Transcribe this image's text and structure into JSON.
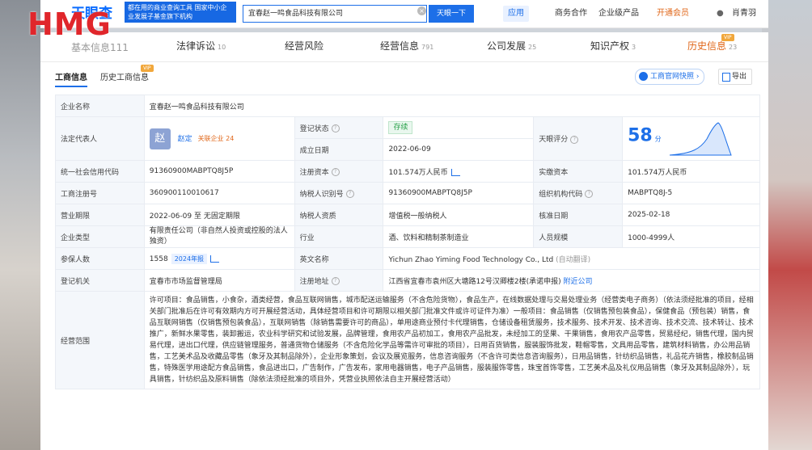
{
  "watermark": "HMG",
  "topbar": {
    "brand": "天眼查",
    "slogan": "都在用的商业查询工具 国家中小企业发展子基金旗下机构",
    "search_value": "宜春赵一鸣食品科技有限公司",
    "search_button": "天眼一下",
    "nav_app": "应用",
    "nav_items": [
      "商务合作",
      "企业级产品",
      "开通会员",
      "肖青羽"
    ]
  },
  "tabs": [
    {
      "label": "基本信息",
      "count": "111"
    },
    {
      "label": "法律诉讼",
      "count": "10"
    },
    {
      "label": "经营风险",
      "count": ""
    },
    {
      "label": "经营信息",
      "count": "791"
    },
    {
      "label": "公司发展",
      "count": "25"
    },
    {
      "label": "知识产权",
      "count": "3"
    },
    {
      "label": "历史信息",
      "count": "23"
    }
  ],
  "vip_label": "VIP",
  "subtabs": [
    "工商信息",
    "历史工商信息"
  ],
  "buttons": {
    "gov": "工商官网快照",
    "export": "导出"
  },
  "info": {
    "company_name_label": "企业名称",
    "company_name": "宜春赵一鸣食品科技有限公司",
    "legal_rep_label": "法定代表人",
    "legal_rep_avatar": "赵",
    "legal_rep_name": "赵定",
    "legal_rep_tag": "关联企业 24",
    "status_label": "登记状态",
    "status": "存续",
    "found_label": "成立日期",
    "found_date": "2022-06-09",
    "score_label": "天眼评分",
    "score": "58",
    "score_unit": "分",
    "credit_code_label": "统一社会信用代码",
    "credit_code": "91360900MABPTQ8J5P",
    "reg_capital_label": "注册资本",
    "reg_capital": "101.574万人民币",
    "paid_capital_label": "实缴资本",
    "paid_capital": "101.574万人民币",
    "reg_no_label": "工商注册号",
    "reg_no": "360900110010617",
    "tax_id_label": "纳税人识别号",
    "tax_id": "91360900MABPTQ8J5P",
    "org_code_label": "组织机构代码",
    "org_code": "MABPTQ8J-5",
    "term_label": "营业期限",
    "term": "2022-06-09 至 无固定期限",
    "tax_qual_label": "纳税人资质",
    "tax_qual": "增值税一般纳税人",
    "approve_label": "核准日期",
    "approve_date": "2025-02-18",
    "type_label": "企业类型",
    "type": "有限责任公司（非自然人投资或控股的法人独资）",
    "industry_label": "行业",
    "industry": "酒、饮料和精制茶制造业",
    "staff_label": "人员规模",
    "staff": "1000-4999人",
    "insured_label": "参保人数",
    "insured": "1558",
    "insured_tag": "2024年报",
    "en_name_label": "英文名称",
    "en_name": "Yichun Zhao Yiming Food Technology Co., Ltd",
    "en_name_note": "(自动翻译)",
    "authority_label": "登记机关",
    "authority": "宜春市市场监督管理局",
    "address_label": "注册地址",
    "address": "江西省宜春市袁州区大塘路12号汉卿楼2楼(承诺申报)",
    "address_link": "附近公司",
    "scope_label": "经营范围",
    "scope": "许可项目：食品销售，小食杂，酒类经营，食品互联网销售，城市配送运输服务（不含危险货物），食品生产，在线数据处理与交易处理业务（经营类电子商务）（依法须经批准的项目，经相关部门批准后在许可有效期内方可开展经营活动，具体经营项目和许可期限以相关部门批准文件或许可证件为准）一般项目：食品销售（仅销售预包装食品），保健食品（预包装）销售，食品互联网销售（仅销售预包装食品），互联网销售（除销售需要许可的商品），单用途商业预付卡代理销售，仓储设备租赁服务，技术服务、技术开发、技术咨询、技术交流、技术转让、技术推广，新鲜水果零售，装卸搬运，农业科学研究和试验发展，品牌管理，食用农产品初加工，食用农产品批发，未经加工的坚果、干果销售，食用农产品零售，贸易经纪，销售代理，国内贸易代理，进出口代理，供应链管理服务，普通货物仓储服务（不含危险化学品等需许可审批的项目），日用百货销售，服装服饰批发，鞋帽零售，文具用品零售，建筑材料销售，办公用品销售，工艺美术品及收藏品零售（象牙及其制品除外），企业形象策划，会议及展览服务，信息咨询服务（不含许可类信息咨询服务），日用品销售，针纺织品销售，礼品花卉销售，橡胶制品销售，特殊医学用途配方食品销售，食品进出口，广告制作，广告发布，家用电器销售，电子产品销售，服装服饰零售，珠宝首饰零售，工艺美术品及礼仪用品销售（象牙及其制品除外），玩具销售，针纺织品及原料销售（除依法须经批准的项目外，凭营业执照依法自主开展经营活动）"
  },
  "colors": {
    "brand": "#1d6fe8",
    "status_green": "#2ba24c",
    "vip_orange": "#e0671a"
  }
}
